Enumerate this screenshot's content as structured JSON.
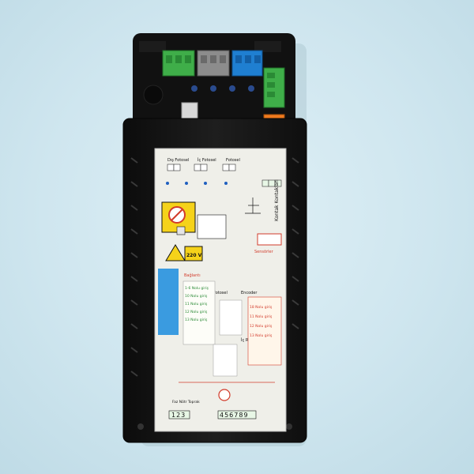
{
  "device": {
    "body_color": "#151515",
    "label_color": "#efefe9",
    "label": {
      "top_left_heading": "Dış Fotosel",
      "top_mid_heading": "İç Fotosel",
      "top_right_heading": "Fotosel",
      "voltage_badge": "220 V",
      "side_title": "Kontak Kontakları",
      "right_red_heading": "Sensörler",
      "section_left": "Bağlantı",
      "section_mid": "Fotosel",
      "section_right": "Encoder",
      "section_bottom": "İç Radar",
      "bottom_left_label": "Faz Nötr Toprak",
      "bottom_left_numbers": "123",
      "bottom_mid_numbers": "456789",
      "right_block_lines": [
        "18 Nolu giriş",
        "11 Nolu giriş",
        "12 Nolu giriş",
        "13 Nolu giriş"
      ],
      "left_block_lines": [
        "1-6 Nolu giriş",
        "10 Nolu giriş",
        "11 Nolu giriş",
        "12 Nolu giriş",
        "13 Nolu giriş"
      ]
    },
    "colors": {
      "terminal_green": "#3fae49",
      "terminal_gray": "#8c8c8c",
      "terminal_blue": "#1f7fd1",
      "terminal_orange": "#f07a1e",
      "blue_patch": "#3a9be0",
      "warning_yellow": "#f5d21a",
      "red_text": "#d23b2b"
    }
  }
}
